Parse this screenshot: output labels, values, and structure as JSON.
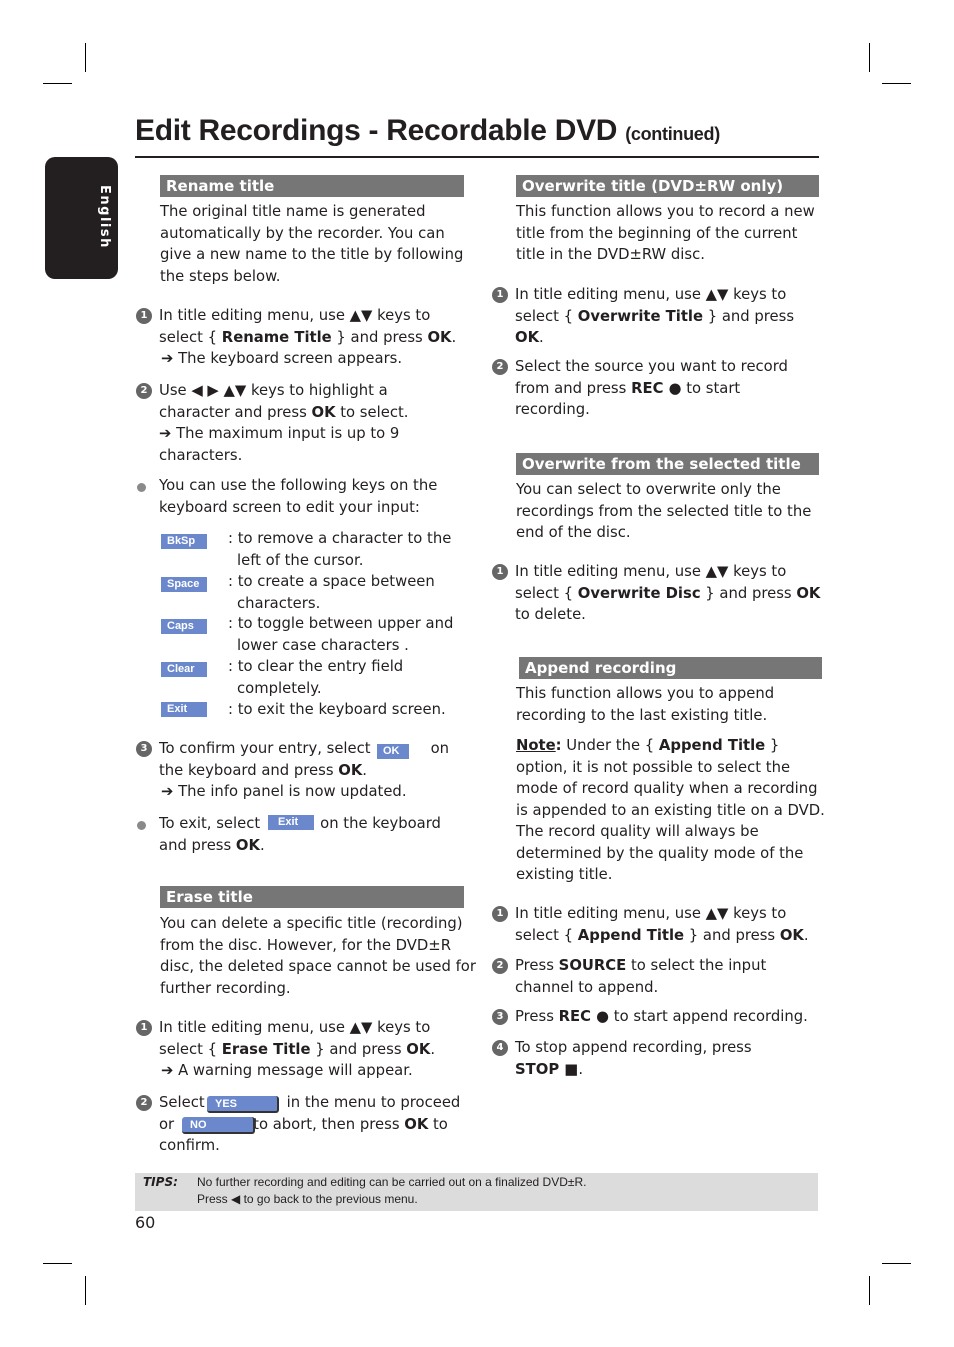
{
  "page": {
    "title": "Edit Recordings - Recordable DVD",
    "title_suffix": "(continued)",
    "language_tab": "English",
    "page_number": "60"
  },
  "rename_title": {
    "heading": "Rename title",
    "intro": [
      "The original title name is generated",
      "automatically by the recorder. You can",
      "give a new name to the title by following",
      "the steps below."
    ],
    "step1": {
      "num": "1",
      "l1": "In title editing menu, use ▲▼ keys to",
      "l2a": "select { ",
      "l2b": "Rename Title",
      "l2c": " } and press ",
      "l2d": "OK",
      "l2e": ".",
      "l3": "➔ The keyboard screen appears."
    },
    "step2": {
      "num": "2",
      "l1": "Use ◀ ▶ ▲▼ keys to highlight a",
      "l2a": "character and press ",
      "l2b": "OK",
      "l2c": " to select.",
      "l3": "➔ The maximum input is up to 9",
      "l4": "characters."
    },
    "bullet1": [
      "You can use the following keys on the",
      "keyboard screen to edit your input:"
    ],
    "keys": [
      {
        "key": "BkSp",
        "l1": ": to remove a character to the",
        "l2": "left of the cursor."
      },
      {
        "key": "Space",
        "l1": ": to create a space between",
        "l2": "characters."
      },
      {
        "key": "Caps",
        "l1": ": to toggle between upper and",
        "l2": "lower case characters ."
      },
      {
        "key": "Clear",
        "l1": ": to clear the entry field",
        "l2": "completely."
      },
      {
        "key": "Exit",
        "l1": ": to exit the keyboard screen.",
        "l2": ""
      }
    ],
    "step3": {
      "num": "3",
      "l1a": "To confirm your entry, select",
      "key": "OK",
      "l1b": "on",
      "l2a": "the keyboard and press ",
      "l2b": "OK",
      "l2c": ".",
      "l3": "➔ The info panel is now updated."
    },
    "bullet2": {
      "l1a": "To exit, select",
      "key": "Exit",
      "l1b": "on the keyboard",
      "l2a": "and press ",
      "l2b": "OK",
      "l2c": "."
    }
  },
  "erase_title": {
    "heading": "Erase title",
    "intro": [
      "You can delete a specific title (recording)",
      "from the disc. However, for the DVD±R",
      "disc, the deleted space cannot be used for",
      "further recording."
    ],
    "step1": {
      "num": "1",
      "l1": "In title editing menu, use ▲▼ keys to",
      "l2a": "select { ",
      "l2b": "Erase Title",
      "l2c": " } and press ",
      "l2d": "OK",
      "l2e": ".",
      "l3": "➔ A warning message will appear."
    },
    "step2": {
      "num": "2",
      "l1a": "Select",
      "yes": "YES",
      "l1b": "in the menu to proceed",
      "l2a": "or",
      "no": "NO",
      "l2b": "to abort, then press ",
      "l2c": "OK",
      "l2d": " to",
      "l3": "confirm."
    }
  },
  "overwrite_title": {
    "heading": "Overwrite title (DVD±RW only)",
    "intro": [
      "This function allows you to record a new",
      "title from the beginning of the current",
      "title in the DVD±RW disc."
    ],
    "step1": {
      "num": "1",
      "l1": "In title editing menu, use ▲▼ keys to",
      "l2a": "select { ",
      "l2b": "Overwrite Title",
      "l2c": " } and press",
      "l3": "OK",
      "l3b": "."
    },
    "step2": {
      "num": "2",
      "l1": "Select the source you want to record",
      "l2a": "from and press ",
      "l2b": "REC ●",
      "l2c": " to start",
      "l3": "recording."
    }
  },
  "overwrite_selected": {
    "heading": "Overwrite from the selected title",
    "intro": [
      "You can select to overwrite only the",
      "recordings from the selected title to the",
      "end of the disc."
    ],
    "step1": {
      "num": "1",
      "l1": "In title editing menu, use ▲▼ keys to",
      "l2a": "select { ",
      "l2b": "Overwrite Disc",
      "l2c": " } and press ",
      "l2d": "OK",
      "l3": "to delete."
    }
  },
  "append_recording": {
    "heading": "Append recording",
    "intro": [
      "This function allows you to append",
      "recording to the last existing title."
    ],
    "note_label": "Note",
    "note_colon": ":",
    "note_l1a": " Under the { ",
    "note_l1b": "Append Title",
    "note_l1c": " }",
    "note_lines": [
      "option, it is not possible to select the",
      "mode of record quality when a recording",
      "is appended to an existing title on a DVD.",
      "The record quality will always be",
      "determined by the quality mode of the",
      "existing title."
    ],
    "step1": {
      "num": "1",
      "l1": "In title editing menu, use ▲▼ keys to",
      "l2a": "select { ",
      "l2b": "Append Title",
      "l2c": " } and press ",
      "l2d": "OK",
      "l2e": "."
    },
    "step2": {
      "num": "2",
      "l1a": "Press ",
      "l1b": "SOURCE",
      "l1c": " to select the input",
      "l2": "channel to append."
    },
    "step3": {
      "num": "3",
      "l1a": "Press ",
      "l1b": "REC ●",
      "l1c": " to start append recording."
    },
    "step4": {
      "num": "4",
      "l1": "To stop append recording, press",
      "l2a": "STOP ■",
      "l2b": "."
    }
  },
  "tips": {
    "label": "TIPS:",
    "lines": [
      "No further recording and editing can be carried out on a finalized DVD±R.",
      "Press ◀ to go back to the previous menu."
    ]
  }
}
